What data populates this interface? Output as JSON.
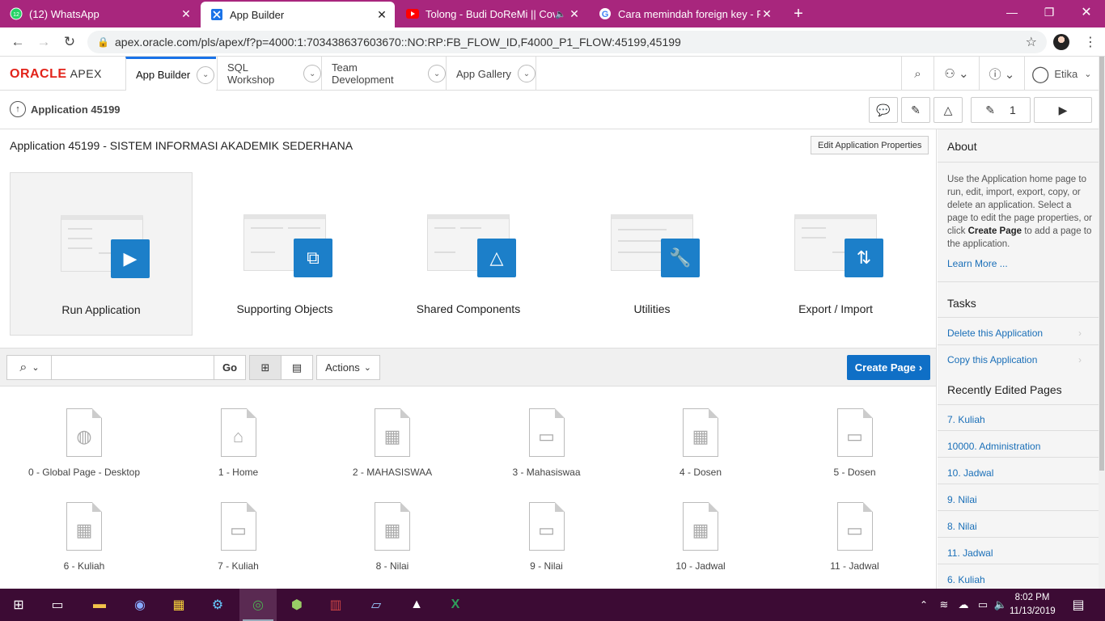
{
  "browser": {
    "tabs": [
      {
        "title": "(12) WhatsApp",
        "icon": "whatsapp-icon",
        "badge": "12"
      },
      {
        "title": "App Builder",
        "icon": "apex-icon",
        "active": true
      },
      {
        "title": "Tolong - Budi DoReMi || Cov",
        "icon": "youtube-icon"
      },
      {
        "title": "Cara memindah foreign key - Per",
        "icon": "google-icon"
      }
    ],
    "url": "apex.oracle.com/pls/apex/f?p=4000:1:703438637603670::NO:RP:FB_FLOW_ID,F4000_P1_FLOW:45199,45199"
  },
  "apex": {
    "logo": "ORACLE",
    "logo_sub": "APEX",
    "menu": [
      "App Builder",
      "SQL Workshop",
      "Team Development",
      "App Gallery"
    ],
    "user": "Etika",
    "breadcrumb": "Application 45199",
    "dev_count": "1"
  },
  "main": {
    "title": "Application 45199 - SISTEM INFORMASI AKADEMIK SEDERHANA",
    "edit_props": "Edit Application Properties",
    "heroes": [
      "Run Application",
      "Supporting Objects",
      "Shared Components",
      "Utilities",
      "Export / Import"
    ],
    "go": "Go",
    "actions": "Actions",
    "create_page": "Create Page",
    "pages": [
      "0 - Global Page - Desktop",
      "1 - Home",
      "2 - MAHASISWAA",
      "3 - Mahasiswaa",
      "4 - Dosen",
      "5 - Dosen",
      "6 - Kuliah",
      "7 - Kuliah",
      "8 - Nilai",
      "9 - Nilai",
      "10 - Jadwal",
      "11 - Jadwal"
    ]
  },
  "sidebar": {
    "about_title": "About",
    "about_pre": "Use the Application home page to run, edit, import, export, copy, or delete an application. Select a page to edit the page properties, or click ",
    "about_bold": "Create Page",
    "about_post": " to add a page to the application.",
    "learn_more": "Learn More ...",
    "tasks_title": "Tasks",
    "tasks": [
      "Delete this Application",
      "Copy this Application"
    ],
    "recent_title": "Recently Edited Pages",
    "recent": [
      "7. Kuliah",
      "10000. Administration",
      "10. Jadwal",
      "9. Nilai",
      "8. Nilai",
      "11. Jadwal",
      "6. Kuliah"
    ]
  },
  "taskbar": {
    "time": "8:02 PM",
    "date": "11/13/2019"
  }
}
